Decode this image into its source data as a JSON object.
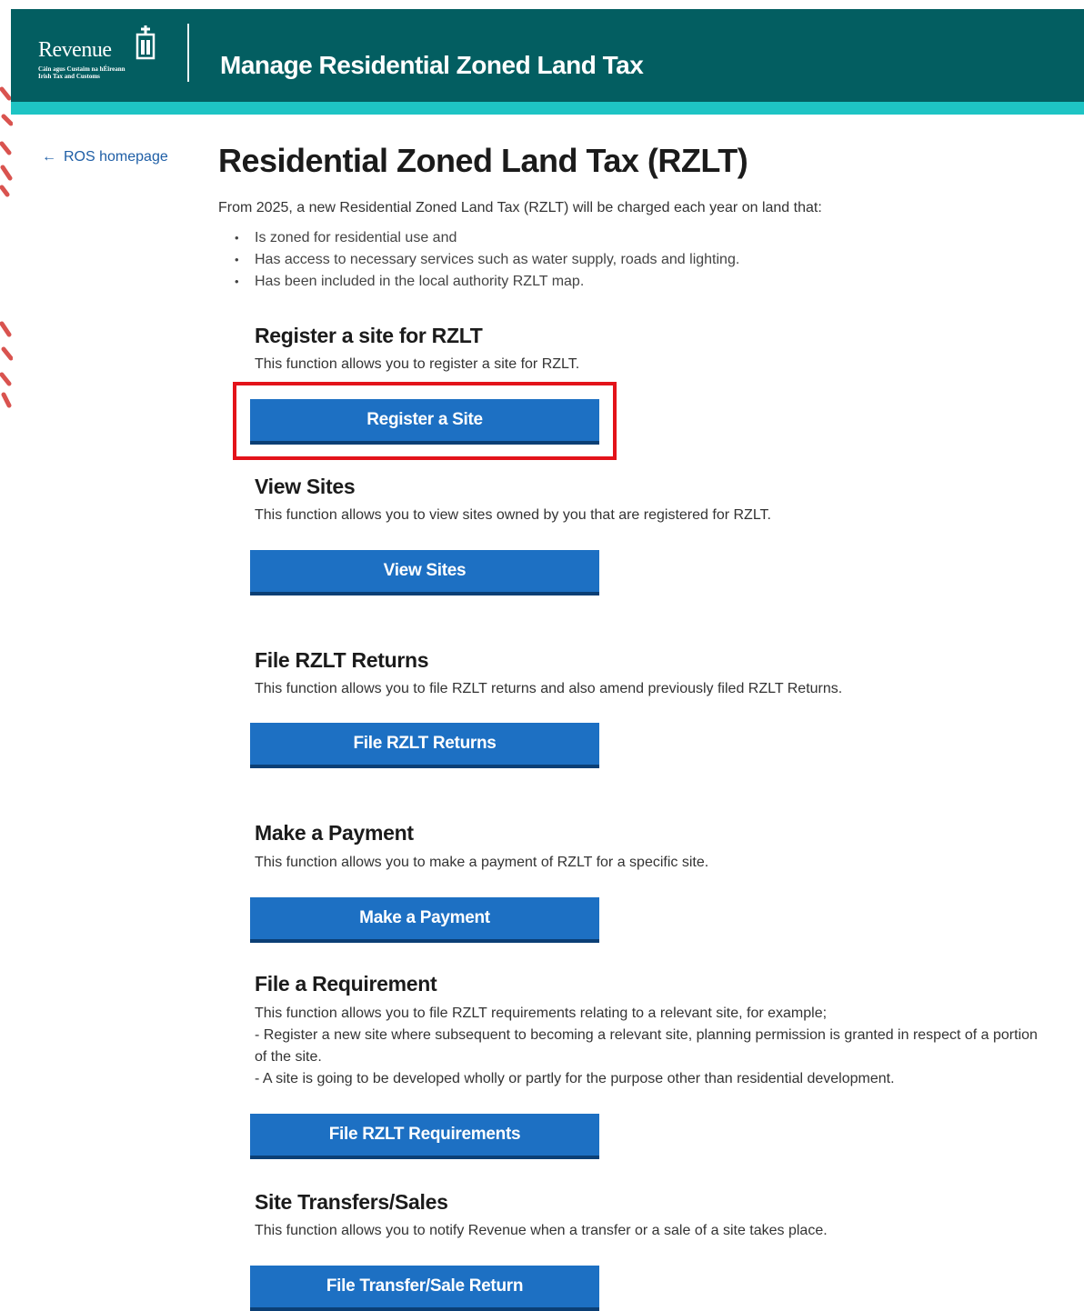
{
  "header": {
    "logo_word": "Revenue",
    "logo_sub_1": "Cáin agus Custaim na hÉireann",
    "logo_sub_2": "Irish Tax and Customs",
    "app_title": "Manage Residential Zoned Land Tax"
  },
  "nav": {
    "back_label": "ROS homepage",
    "back_icon": "arrow-left-icon"
  },
  "main": {
    "title": "Residential Zoned Land Tax (RZLT)",
    "intro": "From 2025, a new Residential Zoned Land Tax (RZLT) will be charged each year on land that:",
    "bullets": [
      "Is zoned for residential use and",
      "Has access to necessary services such as water supply, roads and lighting.",
      "Has been included in the local authority RZLT map."
    ]
  },
  "sections": [
    {
      "heading": "Register a site for RZLT",
      "lines": [
        "This function allows you to register a site for RZLT."
      ],
      "button": "Register a Site"
    },
    {
      "heading": "View Sites",
      "lines": [
        "This function allows you to view sites owned by you that are registered for RZLT."
      ],
      "button": "View Sites"
    },
    {
      "heading": "File RZLT Returns",
      "lines": [
        "This function allows you to file RZLT returns and also amend previously filed RZLT Returns."
      ],
      "button": "File RZLT Returns"
    },
    {
      "heading": "Make a Payment",
      "lines": [
        "This function allows you to make a payment of RZLT for a specific site."
      ],
      "button": "Make a Payment"
    },
    {
      "heading": "File a Requirement",
      "lines": [
        "This function allows you to file RZLT requirements relating to a relevant site, for example;",
        "- Register a new site where subsequent to becoming a relevant site, planning permission is granted in respect of a portion",
        "of the site.",
        "- A site is going to be developed wholly or partly for the purpose other than residential development."
      ],
      "button": "File RZLT Requirements"
    },
    {
      "heading": "Site Transfers/Sales",
      "lines": [
        "This function allows you to notify Revenue when a transfer or a sale of a site takes place."
      ],
      "button": "File Transfer/Sale Return"
    }
  ],
  "colors": {
    "header": "#035e61",
    "strip": "#1ec4c4",
    "button": "#1d70c3",
    "highlight": "#e3131a"
  }
}
